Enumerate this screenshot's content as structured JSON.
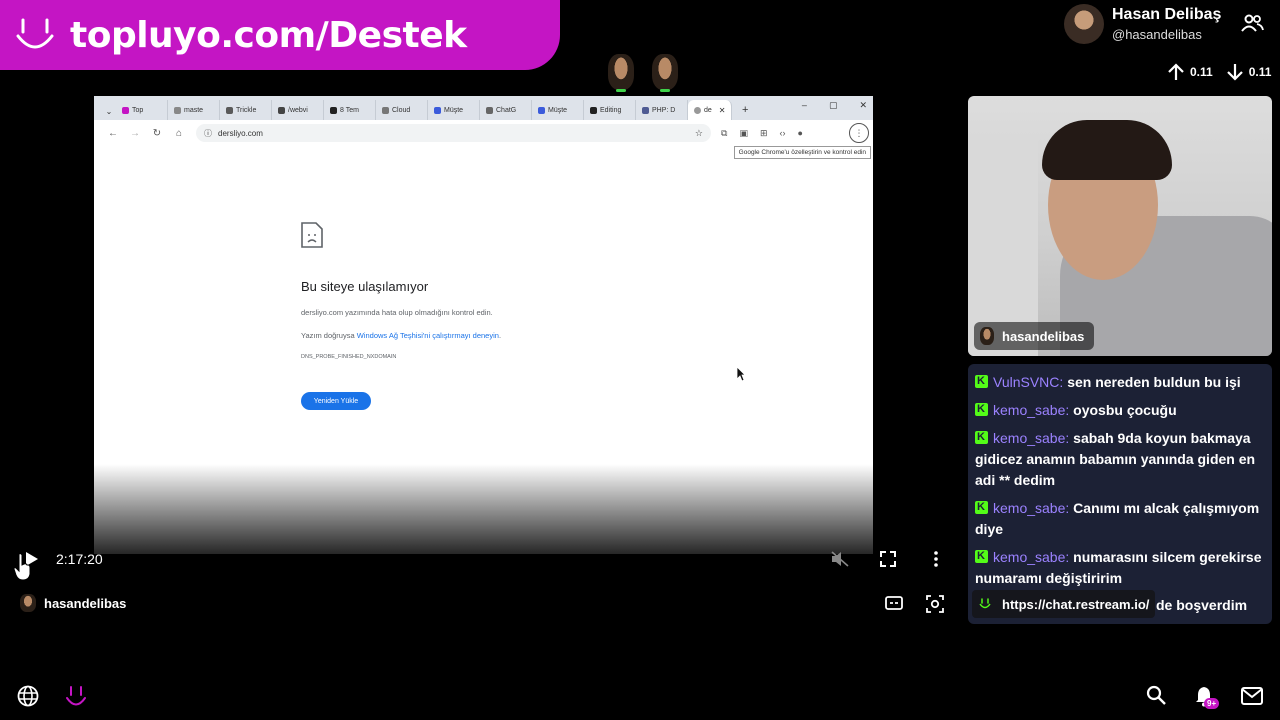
{
  "banner": {
    "text": "topluyo.com/Destek"
  },
  "profile": {
    "name": "Hasan Delibaş",
    "handle": "@hasandelibas"
  },
  "votes": {
    "up": "0.11",
    "down": "0.11"
  },
  "browser": {
    "tabs": [
      {
        "label": "Top",
        "color": "#c415c4"
      },
      {
        "label": "maste",
        "color": "#888888"
      },
      {
        "label": "Trickle",
        "color": "#5a5a5a"
      },
      {
        "label": "/webvi",
        "color": "#444444"
      },
      {
        "label": "8 Tem",
        "color": "#222222"
      },
      {
        "label": "Cloud",
        "color": "#777777"
      },
      {
        "label": "Müşte",
        "color": "#3b5bdb"
      },
      {
        "label": "ChatG",
        "color": "#666666"
      },
      {
        "label": "Müşte",
        "color": "#3b5bdb"
      },
      {
        "label": "Editing",
        "color": "#222222"
      },
      {
        "label": "PHP: D",
        "color": "#4f5b93"
      }
    ],
    "active_tab": "de",
    "url": "dersliyo.com",
    "tooltip": "Google Chrome'u özelleştirin ve kontrol edin"
  },
  "error_page": {
    "title": "Bu siteye ulaşılamıyor",
    "line1": "dersliyo.com yazımında hata olup olmadığını kontrol edin.",
    "line2_prefix": "Yazım doğruysa ",
    "line2_link": "Windows Ağ Teşhisi'ni çalıştırmayı deneyin",
    "line2_suffix": ".",
    "code": "DNS_PROBE_FINISHED_NXDOMAIN",
    "reload_button": "Yeniden Yükle"
  },
  "player": {
    "time": "2:17:20",
    "streamer": "hasandelibas"
  },
  "webcam": {
    "label": "hasandelibas"
  },
  "chat": {
    "messages": [
      {
        "user": "VulnSVNC:",
        "text": "sen nereden buldun bu işi"
      },
      {
        "user": "kemo_sabe:",
        "text": "oyosbu çocuğu"
      },
      {
        "user": "kemo_sabe:",
        "text": "sabah 9da koyun bakmaya gidicez anamın babamın yanında giden en adi ** dedim"
      },
      {
        "user": "kemo_sabe:",
        "text": "Canımı mı alcak çalışmıyom diye"
      },
      {
        "user": "kemo_sabe:",
        "text": "numarasını silcem gerekirse numaramı değiştiririm"
      }
    ],
    "link_label": "https://chat.restream.io/",
    "tail_text": "de boşverdim"
  },
  "bottom": {
    "badge": "9+"
  },
  "colors": {
    "brand": "#c415c4",
    "chat_bg": "#1c2135",
    "username": "#9b82ff",
    "kick_green": "#53fc18"
  }
}
